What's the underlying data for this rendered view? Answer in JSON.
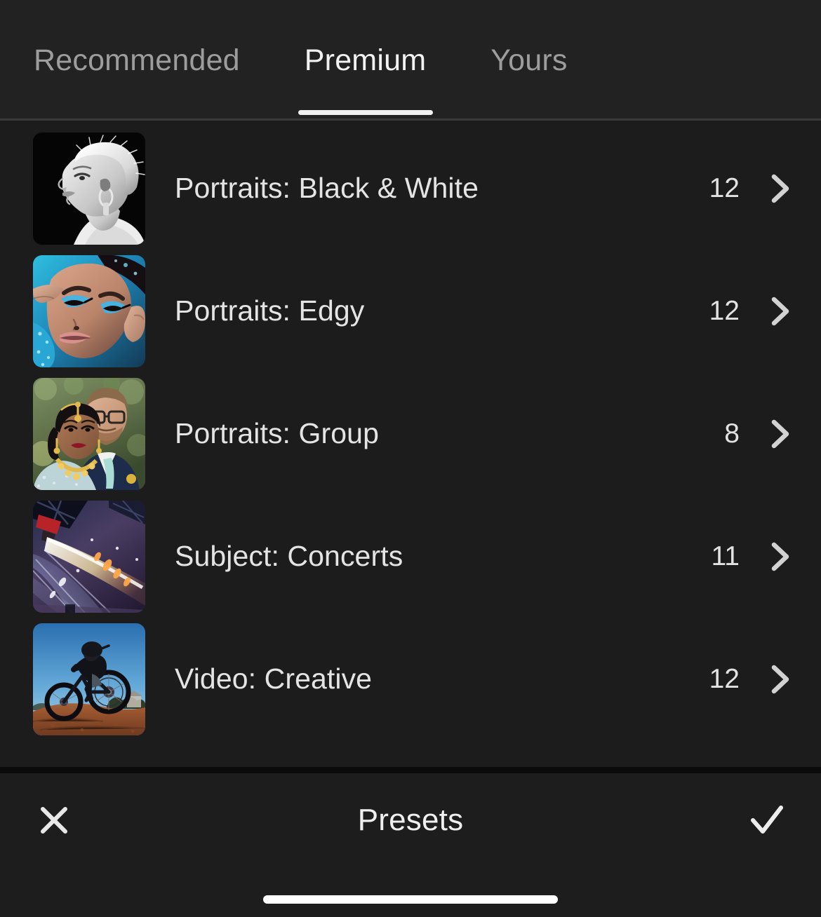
{
  "panel": {
    "title": "Presets"
  },
  "tabs": [
    {
      "label": "Recommended",
      "active": false
    },
    {
      "label": "Premium",
      "active": true
    },
    {
      "label": "Yours",
      "active": false
    }
  ],
  "presets": [
    {
      "label": "Portraits: Black & White",
      "count": "12",
      "thumbnail": "portrait-black-and-white-thumbnail",
      "chevron": "chevron-right-icon"
    },
    {
      "label": "Portraits: Edgy",
      "count": "12",
      "thumbnail": "portrait-edgy-blue-makeup-thumbnail",
      "chevron": "chevron-right-icon"
    },
    {
      "label": "Portraits: Group",
      "count": "8",
      "thumbnail": "portrait-group-wedding-couple-thumbnail",
      "chevron": "chevron-right-icon"
    },
    {
      "label": "Subject: Concerts",
      "count": "11",
      "thumbnail": "concert-stage-lights-thumbnail",
      "chevron": "chevron-right-icon"
    },
    {
      "label": "Video: Creative",
      "count": "12",
      "thumbnail": "mountain-biker-sky-thumbnail",
      "chevron": "chevron-right-icon"
    }
  ],
  "bottom_bar": {
    "cancel_icon": "close-x-icon",
    "confirm_icon": "checkmark-icon"
  },
  "colors": {
    "background": "#1c1c1c",
    "tabbar_background": "#222222",
    "active_tab_text": "#f2f2f2",
    "inactive_tab_text": "#9d9d9d",
    "active_tab_underline": "#f1f1f1",
    "row_label_text": "#e4e4e4",
    "count_text": "#e2e2e2",
    "chevron": "#d2d2d2",
    "bottom_bar_background": "#1d1d1d",
    "home_indicator": "#ffffff"
  }
}
